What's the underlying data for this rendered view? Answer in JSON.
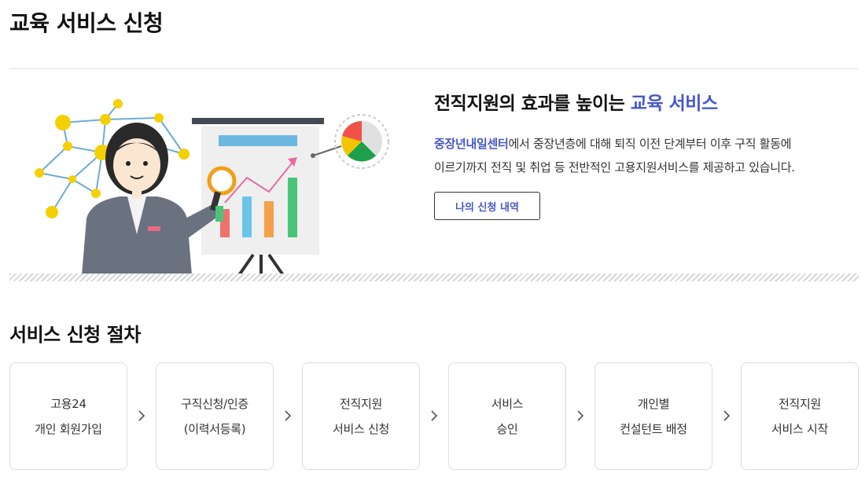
{
  "page": {
    "title": "교육 서비스 신청"
  },
  "hero": {
    "heading_prefix": "전직지원의 효과를 높이는 ",
    "heading_accent": "교육 서비스",
    "center_name": "중장년내일센터",
    "desc_line1_rest": "에서 중장년층에 대해 퇴직 이전 단계부터 이후 구직 활동에",
    "desc_line2": "이르기까지 전직 및 취업 등 전반적인 고용지원서비스를 제공하고 있습니다.",
    "button_label": "나의 신청 내역"
  },
  "procedure": {
    "title": "서비스 신청 절차",
    "steps": [
      {
        "line1": "고용24",
        "line2": "개인 회원가입"
      },
      {
        "line1": "구직신청/인증",
        "line2": "(이력서등록)"
      },
      {
        "line1": "전직지원",
        "line2": "서비스 신청"
      },
      {
        "line1": "서비스",
        "line2": "승인"
      },
      {
        "line1": "개인별",
        "line2": "컨설턴트 배정"
      },
      {
        "line1": "전직지원",
        "line2": "서비스 시작"
      }
    ]
  },
  "colors": {
    "accent": "#4758c7",
    "text": "#111111",
    "border": "#dcdcdc"
  }
}
